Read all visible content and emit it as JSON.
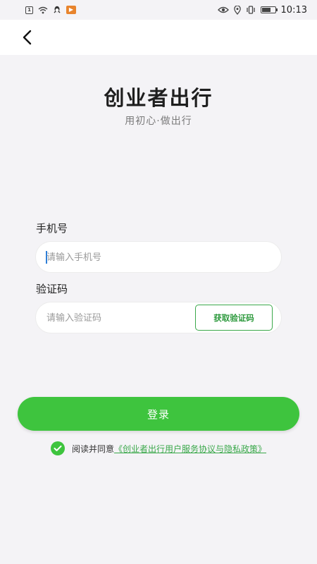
{
  "status_bar": {
    "left_icons": [
      "sim-icon",
      "wifi-icon",
      "qq-icon",
      "app-notification-icon"
    ],
    "right_icons": [
      "eye-icon",
      "location-icon",
      "vibrate-icon",
      "battery-icon"
    ],
    "time": "10:13"
  },
  "header": {
    "back_icon": "chevron-left-icon"
  },
  "brand": {
    "title": "创业者出行",
    "subtitle": "用初心·做出行"
  },
  "form": {
    "phone_label": "手机号",
    "phone_placeholder": "请输入手机号",
    "code_label": "验证码",
    "code_placeholder": "请输入验证码",
    "get_code_label": "获取验证码"
  },
  "login_label": "登录",
  "agreement": {
    "checked": true,
    "text": "阅读并同意",
    "link": "《创业者出行用户服务协议与隐私政策》"
  },
  "colors": {
    "accent": "#3ec43e",
    "link": "#3aa84a",
    "background": "#f4f3f6"
  }
}
